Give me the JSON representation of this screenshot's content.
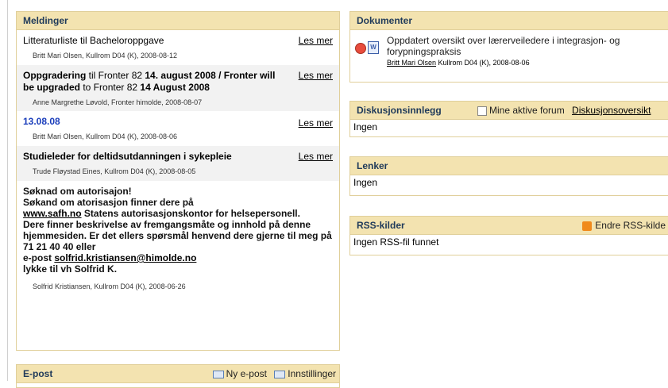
{
  "meldinger": {
    "header": "Meldinger",
    "items": [
      {
        "title": "Litteraturliste til Bacheloroppgave",
        "les": "Les mer",
        "meta": "Britt Mari Olsen,  Kullrom D04 (K),  2008-08-12"
      },
      {
        "title_p1": "Oppgradering",
        "title_p2": " til Fronter 82 ",
        "title_p3": "14. august 2008 / Fronter will be upgraded",
        "title_p4": " to Fronter 82 ",
        "title_p5": "14 August 2008",
        "les": "Les mer",
        "meta": "Anne Margrethe Løvold,  Fronter himolde,  2008-08-07"
      },
      {
        "title": "13.08.08",
        "les": "Les mer",
        "meta": "Britt Mari Olsen,  Kullrom D04 (K),  2008-08-06"
      },
      {
        "title": "Studieleder for deltidsutdanningen i sykepleie",
        "les": "Les mer",
        "meta": "Trude Fløystad Eines,  Kullrom D04 (K),  2008-08-05"
      }
    ],
    "long": {
      "l1": "Søknad om autorisajon!",
      "l2": "Søkand om atorisasjon finner dere på",
      "link1": "www.safh.no",
      "l3": " Statens autorisasjonskontor for helsepersonell.",
      "l4": "Dere finner beskrivelse av fremgangsmåte og innhold på denne hjemmesiden.  Er det ellers spørsmål henvend dere gjerne til meg på 71 21 40 40 eller",
      "l5": "e-post ",
      "link2": "solfrid.kristiansen@himolde.no",
      "l6": "lykke til vh Solfrid K.",
      "meta": "Solfrid Kristiansen,  Kullrom D04 (K),  2008-06-26"
    }
  },
  "epost": {
    "header": "E-post",
    "ny": "Ny e-post",
    "innst": "Innstillinger"
  },
  "dokumenter": {
    "header": "Dokumenter",
    "title": "Oppdatert oversikt over lærerveiledere i integrasjon- og forypningspraksis",
    "author": "Britt Mari Olsen",
    "meta": " Kullrom D04 (K),  2008-08-06"
  },
  "diskusjon": {
    "header": "Diskusjonsinnlegg",
    "checkbox": "Mine aktive forum",
    "link": "Diskusjonsoversikt",
    "body": "Ingen"
  },
  "lenker": {
    "header": "Lenker",
    "body": "Ingen"
  },
  "rss": {
    "header": "RSS-kilder",
    "endre": "Endre RSS-kilde",
    "body": "Ingen RSS-fil funnet"
  },
  "colors": {
    "header_bg": "#f3e3b0",
    "header_text": "#1f3a5a",
    "border": "#e0cf9a",
    "rss_orange": "#f08a1c"
  }
}
